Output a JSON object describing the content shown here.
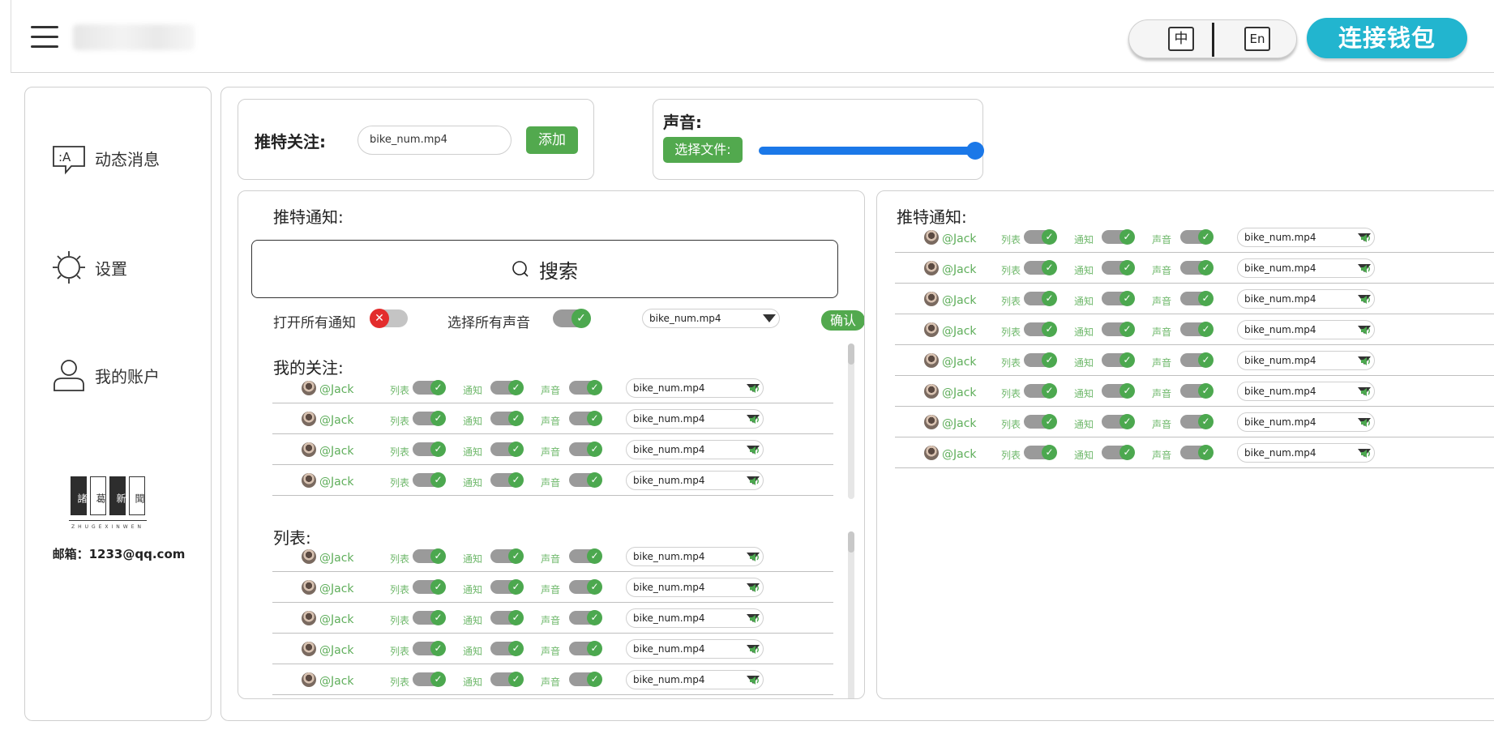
{
  "header": {
    "lang_zh": "中",
    "lang_en": "En",
    "connect_wallet": "连接钱包"
  },
  "sidebar": {
    "items": [
      {
        "label": "动态消息",
        "icon": "message-icon"
      },
      {
        "label": "设置",
        "icon": "sun-settings-icon"
      },
      {
        "label": "我的账户",
        "icon": "user-icon"
      }
    ],
    "brand_chars": [
      "諸",
      "葛",
      "新",
      "聞"
    ],
    "brand_sub": "ZHUGEXINWEN",
    "email": "邮箱：1233@qq.com"
  },
  "follow_card": {
    "label": "推特关注:",
    "input_value": "bike_num.mp4",
    "add_button": "添加"
  },
  "sound_card": {
    "label": "声音:",
    "file_button": "选择文件:",
    "volume": 1.0
  },
  "left_panel": {
    "title": "推特通知:",
    "search_placeholder": "搜索",
    "open_all_label": "打开所有通知",
    "open_all_on": false,
    "select_all_label": "选择所有声音",
    "select_all_on": true,
    "sound_select": "bike_num.mp4",
    "confirm": "确认",
    "following_title": "我的关注:",
    "list_title": "列表:",
    "following_count": 4,
    "list_count": 5
  },
  "right_panel": {
    "title": "推特通知:",
    "row_count": 8
  },
  "row_template": {
    "handle": "@Jack",
    "list_label": "列表",
    "notify_label": "通知",
    "sound_label": "声音",
    "file": "bike_num.mp4"
  },
  "colors": {
    "accent_cyan": "#22b5cf",
    "green": "#52a94e",
    "blue_slider": "#1b78e8",
    "toggle_off_red": "#e32c2c"
  }
}
